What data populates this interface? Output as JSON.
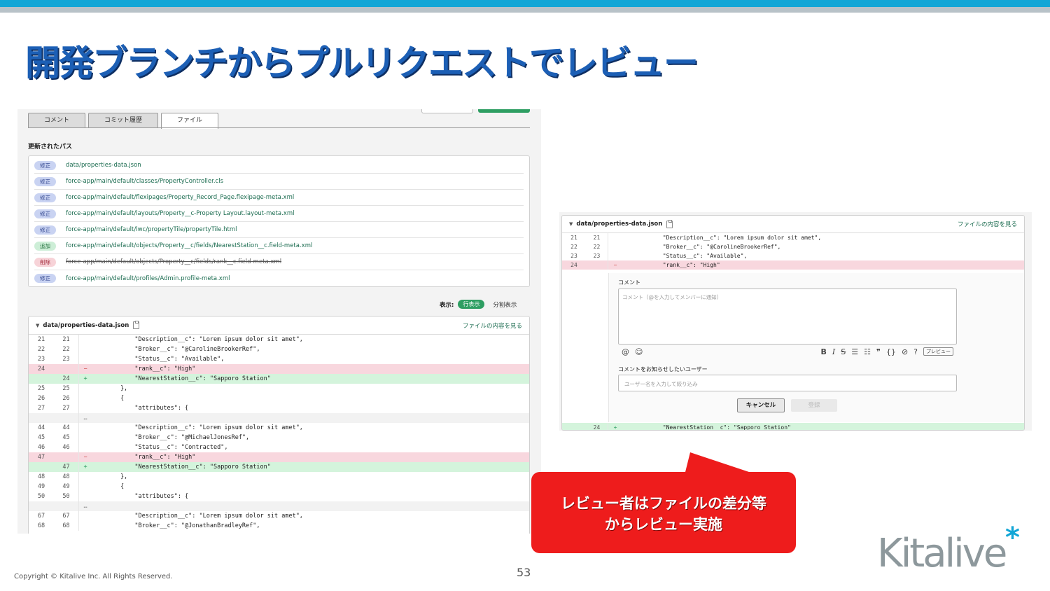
{
  "slide": {
    "title": "開発ブランチからプルリクエストでレビュー",
    "page_number": "53",
    "copyright": "Copyright © Kitalive Inc. All Rights Reserved.",
    "logo_text": "Kitalive",
    "logo_star": "*",
    "callout_line1": "レビュー者はファイルの差分等",
    "callout_line2": "からレビュー実施",
    "colors": {
      "accent": "#12a6d6",
      "title": "#1c5fb5",
      "callout": "#ee1c1c",
      "green": "#2e9e62"
    }
  },
  "left": {
    "tabs": [
      "コメント",
      "コミット履歴",
      "ファイル"
    ],
    "active_tab": "ファイル",
    "updated_paths_label": "更新されたパス",
    "files": [
      {
        "badge": "修正",
        "kind": "mod",
        "path": "data/properties-data.json"
      },
      {
        "badge": "修正",
        "kind": "mod",
        "path": "force-app/main/default/classes/PropertyController.cls"
      },
      {
        "badge": "修正",
        "kind": "mod",
        "path": "force-app/main/default/flexipages/Property_Record_Page.flexipage-meta.xml"
      },
      {
        "badge": "修正",
        "kind": "mod",
        "path": "force-app/main/default/layouts/Property__c-Property Layout.layout-meta.xml"
      },
      {
        "badge": "修正",
        "kind": "mod",
        "path": "force-app/main/default/lwc/propertyTile/propertyTile.html"
      },
      {
        "badge": "追加",
        "kind": "add",
        "path": "force-app/main/default/objects/Property__c/fields/NearestStation__c.field-meta.xml"
      },
      {
        "badge": "削除",
        "kind": "del",
        "path": "force-app/main/default/objects/Property__c/fields/rank__c.field-meta.xml"
      },
      {
        "badge": "修正",
        "kind": "mod",
        "path": "force-app/main/default/profiles/Admin.profile-meta.xml"
      }
    ],
    "view_label": "表示:",
    "view_active": "行表示",
    "view_alt": "分割表示",
    "diff_file": "data/properties-data.json",
    "view_file_link": "ファイルの内容を見る",
    "diff_rows": [
      {
        "type": "ctx",
        "old": "21",
        "new": "21",
        "mark": "",
        "code": "            \"Description__c\": \"Lorem ipsum dolor sit amet\","
      },
      {
        "type": "ctx",
        "old": "22",
        "new": "22",
        "mark": "",
        "code": "            \"Broker__c\": \"@CarolineBrookerRef\","
      },
      {
        "type": "ctx",
        "old": "23",
        "new": "23",
        "mark": "",
        "code": "            \"Status__c\": \"Available\","
      },
      {
        "type": "del",
        "old": "24",
        "new": "",
        "mark": "−",
        "code": "            \"rank__c\": \"High\""
      },
      {
        "type": "add",
        "old": "",
        "new": "24",
        "mark": "+",
        "code": "            \"NearestStation__c\": \"Sapporo Station\""
      },
      {
        "type": "ctx",
        "old": "25",
        "new": "25",
        "mark": "",
        "code": "        },"
      },
      {
        "type": "ctx",
        "old": "26",
        "new": "26",
        "mark": "",
        "code": "        {"
      },
      {
        "type": "ctx",
        "old": "27",
        "new": "27",
        "mark": "",
        "code": "            \"attributes\": {"
      },
      {
        "type": "gap",
        "old": "",
        "new": "",
        "mark": "…",
        "code": ""
      },
      {
        "type": "ctx",
        "old": "44",
        "new": "44",
        "mark": "",
        "code": "            \"Description__c\": \"Lorem ipsum dolor sit amet\","
      },
      {
        "type": "ctx",
        "old": "45",
        "new": "45",
        "mark": "",
        "code": "            \"Broker__c\": \"@MichaelJonesRef\","
      },
      {
        "type": "ctx",
        "old": "46",
        "new": "46",
        "mark": "",
        "code": "            \"Status__c\": \"Contracted\","
      },
      {
        "type": "del",
        "old": "47",
        "new": "",
        "mark": "−",
        "code": "            \"rank__c\": \"High\""
      },
      {
        "type": "add",
        "old": "",
        "new": "47",
        "mark": "+",
        "code": "            \"NearestStation__c\": \"Sapporo Station\""
      },
      {
        "type": "ctx",
        "old": "48",
        "new": "48",
        "mark": "",
        "code": "        },"
      },
      {
        "type": "ctx",
        "old": "49",
        "new": "49",
        "mark": "",
        "code": "        {"
      },
      {
        "type": "ctx",
        "old": "50",
        "new": "50",
        "mark": "",
        "code": "            \"attributes\": {"
      },
      {
        "type": "gap",
        "old": "",
        "new": "",
        "mark": "…",
        "code": ""
      },
      {
        "type": "ctx",
        "old": "67",
        "new": "67",
        "mark": "",
        "code": "            \"Description__c\": \"Lorem ipsum dolor sit amet\","
      },
      {
        "type": "ctx",
        "old": "68",
        "new": "68",
        "mark": "",
        "code": "            \"Broker__c\": \"@JonathanBradleyRef\","
      }
    ]
  },
  "right": {
    "diff_file": "data/properties-data.json",
    "view_file_link": "ファイルの内容を見る",
    "diff_rows": [
      {
        "type": "ctx",
        "old": "21",
        "new": "21",
        "mark": "",
        "code": "            \"Description__c\": \"Lorem ipsum dolor sit amet\","
      },
      {
        "type": "ctx",
        "old": "22",
        "new": "22",
        "mark": "",
        "code": "            \"Broker__c\": \"@CarolineBrookerRef\","
      },
      {
        "type": "ctx",
        "old": "23",
        "new": "23",
        "mark": "",
        "code": "            \"Status__c\": \"Available\","
      },
      {
        "type": "del",
        "old": "24",
        "new": "",
        "mark": "−",
        "code": "            \"rank__c\": \"High\""
      }
    ],
    "comment_label": "コメント",
    "comment_placeholder": "コメント（@を入力してメンバーに通知）",
    "toolbar": {
      "at": "@",
      "emoji": "☺",
      "bold": "B",
      "italic": "I",
      "strike": "S",
      "ul": "☰",
      "ol": "☷",
      "quote": "❞",
      "code": "{}",
      "link": "⊘",
      "help": "?",
      "preview": "プレビュー"
    },
    "notify_label": "コメントをお知らせしたいユーザー",
    "notify_placeholder": "ユーザー名を入力して絞り込み",
    "cancel": "キャンセル",
    "register": "登録",
    "last_row": {
      "type": "add",
      "old": "",
      "new": "24",
      "mark": "+",
      "code": "            \"NearestStation__c\": \"Sapporo Station\""
    }
  }
}
